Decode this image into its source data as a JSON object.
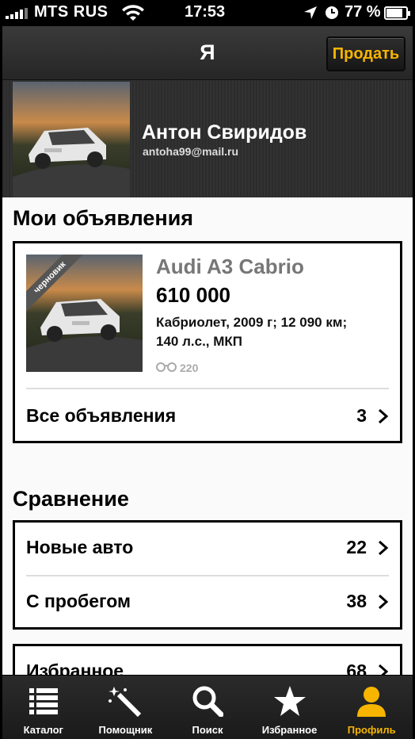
{
  "status_bar": {
    "carrier": "MTS RUS",
    "time": "17:53",
    "battery": "77 %"
  },
  "nav": {
    "title": "Я",
    "sell_button": "Продать"
  },
  "profile": {
    "name": "Антон Свиридов",
    "email": "antoha99@mail.ru"
  },
  "my_ads": {
    "title": "Мои объявления",
    "listing": {
      "ribbon": "черновик",
      "car_title": "Audi A3 Cabrio",
      "price": "610 000",
      "specs_line1": "Кабриолет, 2009 г; 12 090 км;",
      "specs_line2": "140 л.с., МКП",
      "views": "220"
    },
    "all_ads_label": "Все объявления",
    "all_ads_count": "3"
  },
  "comparison": {
    "title": "Сравнение",
    "rows": [
      {
        "label": "Новые авто",
        "count": "22"
      },
      {
        "label": "С пробегом",
        "count": "38"
      }
    ]
  },
  "favorites": {
    "label": "Избранное",
    "count": "68"
  },
  "tabs": [
    {
      "label": "Каталог",
      "icon": "list-icon"
    },
    {
      "label": "Помощник",
      "icon": "magic-wand-icon"
    },
    {
      "label": "Поиск",
      "icon": "search-icon"
    },
    {
      "label": "Избранное",
      "icon": "star-icon"
    },
    {
      "label": "Профиль",
      "icon": "user-icon"
    }
  ],
  "colors": {
    "accent": "#f7b500",
    "header_bg": "#2e2e2e"
  }
}
